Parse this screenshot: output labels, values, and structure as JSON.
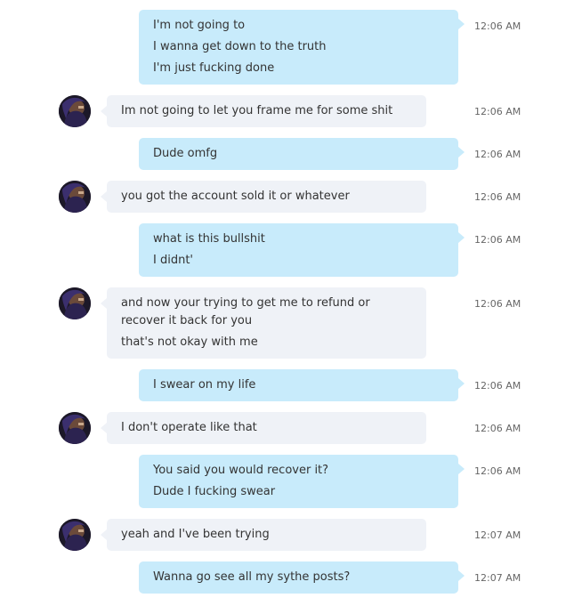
{
  "messages": [
    {
      "dir": "out",
      "lines": [
        "I'm not going to",
        "I wanna get down to the truth",
        "I'm just fucking done"
      ],
      "time": "12:06 AM"
    },
    {
      "dir": "in",
      "lines": [
        "Im not going to let you frame me for some shit"
      ],
      "time": "12:06 AM"
    },
    {
      "dir": "out",
      "lines": [
        "Dude omfg"
      ],
      "time": "12:06 AM"
    },
    {
      "dir": "in",
      "lines": [
        "you got the account sold it or whatever"
      ],
      "time": "12:06 AM"
    },
    {
      "dir": "out",
      "lines": [
        "what is this bullshit",
        "I didnt'"
      ],
      "time": "12:06 AM"
    },
    {
      "dir": "in",
      "lines": [
        "and now your trying to get me to refund or recover it back for you",
        "that's not okay with me"
      ],
      "time": "12:06 AM"
    },
    {
      "dir": "out",
      "lines": [
        "I swear on my life"
      ],
      "time": "12:06 AM"
    },
    {
      "dir": "in",
      "lines": [
        "I don't operate like that"
      ],
      "time": "12:06 AM"
    },
    {
      "dir": "out",
      "lines": [
        "You said you would recover it?",
        "Dude I fucking swear"
      ],
      "time": "12:06 AM"
    },
    {
      "dir": "in",
      "lines": [
        "yeah and I've been trying"
      ],
      "time": "12:07 AM"
    },
    {
      "dir": "out",
      "lines": [
        "Wanna go see all my sythe posts?"
      ],
      "time": "12:07 AM"
    }
  ],
  "colors": {
    "outgoing_bubble": "#c8ebfb",
    "incoming_bubble": "#eff2f7",
    "timestamp": "#666666",
    "text": "#333333"
  },
  "icons": {
    "avatar": "user-avatar-icon"
  }
}
